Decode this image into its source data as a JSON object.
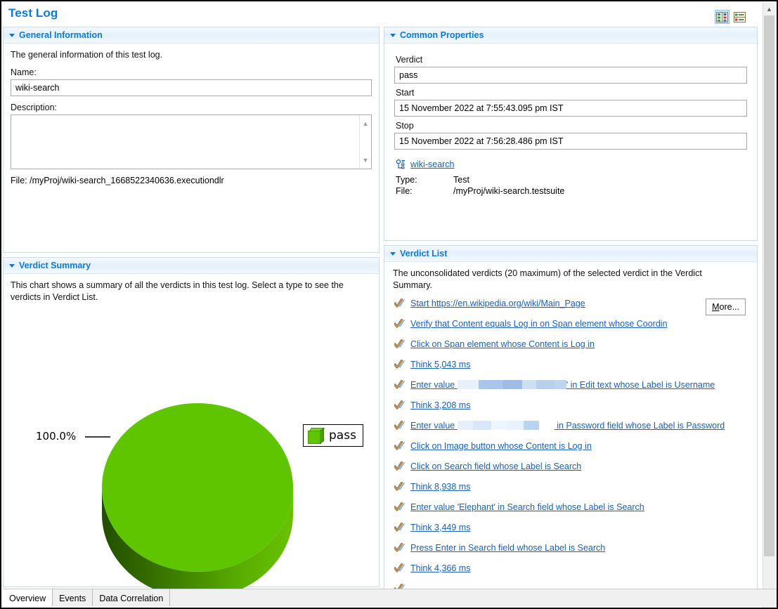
{
  "window": {
    "title": "Test Log"
  },
  "toolbar": {
    "buttons": [
      {
        "icon": "two-column-layout-icon",
        "selected": true
      },
      {
        "icon": "single-column-layout-icon",
        "selected": false
      }
    ]
  },
  "general_information": {
    "header": "General Information",
    "description": "The general information of this test log.",
    "name_label": "Name:",
    "name_value": "wiki-search",
    "description_label": "Description:",
    "description_value": "",
    "description_placeholder": "",
    "file_label": "File:",
    "file_value": "/myProj/wiki-search_1668522340636.executiondlr"
  },
  "verdict_summary": {
    "header": "Verdict Summary",
    "description": "This chart shows a summary of all the verdicts in this test log. Select a type to see the verdicts in Verdict List."
  },
  "chart_data": {
    "type": "pie",
    "title": "Verdict Summary",
    "categories": [
      "pass"
    ],
    "values": [
      100.0
    ],
    "labels": [
      "100.0%"
    ],
    "colors": [
      "#5fc500"
    ],
    "legend": [
      "pass"
    ],
    "legend_position": "right",
    "three_d": true,
    "units": "percent"
  },
  "common_properties": {
    "header": "Common Properties",
    "verdict_label": "Verdict",
    "verdict_value": "pass",
    "start_label": "Start",
    "start_value": "15 November 2022 at 7:55:43.095 pm IST",
    "stop_label": "Stop",
    "stop_value": "15 November 2022 at 7:56:28.486 pm IST",
    "link_icon": "test-suite-icon",
    "link_text": "wiki-search",
    "type_label": "Type:",
    "type_value": "Test",
    "file_label": "File:",
    "file_value": "/myProj/wiki-search.testsuite"
  },
  "verdict_list": {
    "header": "Verdict List",
    "description": "The unconsolidated verdicts (20 maximum) of the selected verdict in the Verdict Summary.",
    "more_button": "More...",
    "more_button_mnemonic": "M",
    "items": [
      {
        "icon": "verdict-pass-icon",
        "text": "Start https://en.wikipedia.org/wiki/Main_Page"
      },
      {
        "icon": "verdict-pass-icon",
        "text": "Verify that Content equals Log in on Span element whose Coordin"
      },
      {
        "icon": "verdict-pass-icon",
        "text": "Click on Span element whose Content is Log in"
      },
      {
        "icon": "verdict-pass-icon",
        "text": "Think 5,043 ms"
      },
      {
        "icon": "verdict-pass-icon",
        "text_before": "Enter value ",
        "redacted": true,
        "text_after": "' in Edit text whose Label is Username"
      },
      {
        "icon": "verdict-pass-icon",
        "text": "Think 3,208 ms"
      },
      {
        "icon": "verdict-pass-icon",
        "text_before": "Enter value ",
        "redacted": true,
        "text_after": " in Password field whose Label is Password"
      },
      {
        "icon": "verdict-pass-icon",
        "text": "Click on Image button whose Content is Log in"
      },
      {
        "icon": "verdict-pass-icon",
        "text": "Click on Search field whose Label is Search"
      },
      {
        "icon": "verdict-pass-icon",
        "text": "Think 8,938 ms"
      },
      {
        "icon": "verdict-pass-icon",
        "text": "Enter value 'Elephant' in Search field whose Label is Search"
      },
      {
        "icon": "verdict-pass-icon",
        "text": "Think 3,449 ms"
      },
      {
        "icon": "verdict-pass-icon",
        "text": "Press Enter in Search field whose Label is Search"
      },
      {
        "icon": "verdict-pass-icon",
        "text": "Think 4,366 ms"
      }
    ]
  },
  "tabs": [
    {
      "label": "Overview",
      "active": true
    },
    {
      "label": "Events",
      "active": false
    },
    {
      "label": "Data Correlation",
      "active": false
    }
  ],
  "colors": {
    "accent": "#0f7ad1",
    "link": "#1a5fb4",
    "pass_green": "#5fc500",
    "panel_border": "#c6dcf0"
  }
}
